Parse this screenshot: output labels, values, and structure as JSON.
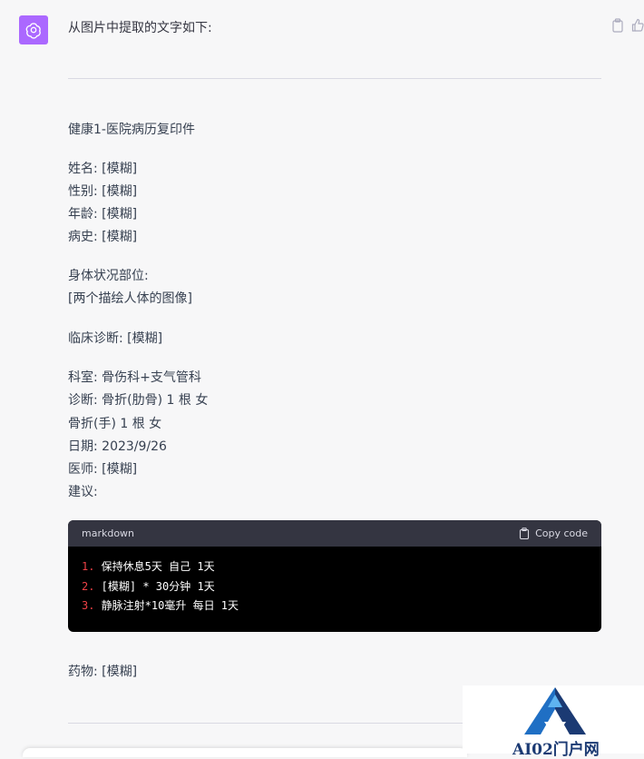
{
  "message": {
    "intro": "从图片中提取的文字如下:",
    "title": "健康1-医院病历复印件",
    "fields": [
      "姓名: [模糊]",
      "性别: [模糊]",
      "年龄: [模糊]",
      "病史: [模糊]"
    ],
    "body_section": [
      "身体状况部位:",
      "[两个描绘人体的图像]"
    ],
    "clinical": "临床诊断: [模糊]",
    "details": [
      "科室: 骨伤科+支气管科",
      "诊断: 骨折(肋骨) 1 根 女",
      "骨折(手) 1 根 女",
      "日期: 2023/9/26",
      "医师: [模糊]",
      "建议:"
    ],
    "code": {
      "language": "markdown",
      "copy_label": "Copy code",
      "lines": [
        {
          "num": "1.",
          "text": " 保持休息5天 自己 1天"
        },
        {
          "num": "2.",
          "text": " [模糊] * 30分钟 1天"
        },
        {
          "num": "3.",
          "text": " 静脉注射*10毫升 每日 1天"
        }
      ]
    },
    "medication": "药物: [模糊]"
  },
  "watermark": {
    "text": "AI02门户网"
  },
  "icons": {
    "avatar": "chatgpt-logo-icon",
    "copy": "clipboard-icon",
    "like": "thumbs-up-icon"
  },
  "colors": {
    "avatar_bg": "#ab68ff",
    "code_bg": "#000000",
    "code_header_bg": "#343541",
    "code_number": "#ef4146"
  }
}
